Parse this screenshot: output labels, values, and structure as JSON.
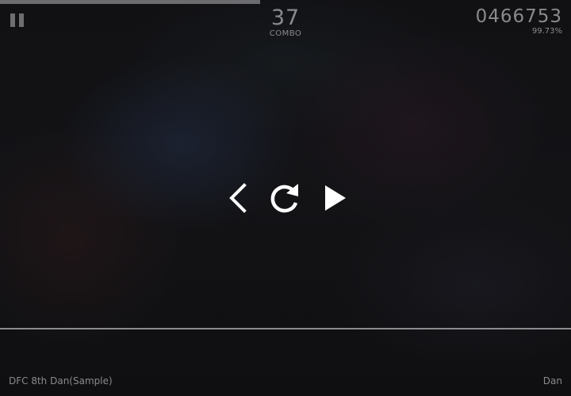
{
  "progress": {
    "fraction": 0.455
  },
  "hud": {
    "combo_value": "37",
    "combo_label": "COMBO",
    "score_value": "0466753",
    "accuracy": "99.73%"
  },
  "pause_menu": {
    "icons": [
      "chevron-left-icon",
      "retry-icon",
      "play-icon"
    ]
  },
  "footer": {
    "song_title": "DFC 8th Dan(Sample)",
    "difficulty": "Dan"
  },
  "colors": {
    "hud_text": "#8a8a8c",
    "control_icons": "#ffffff",
    "judge_line": "#8c8c8e"
  }
}
